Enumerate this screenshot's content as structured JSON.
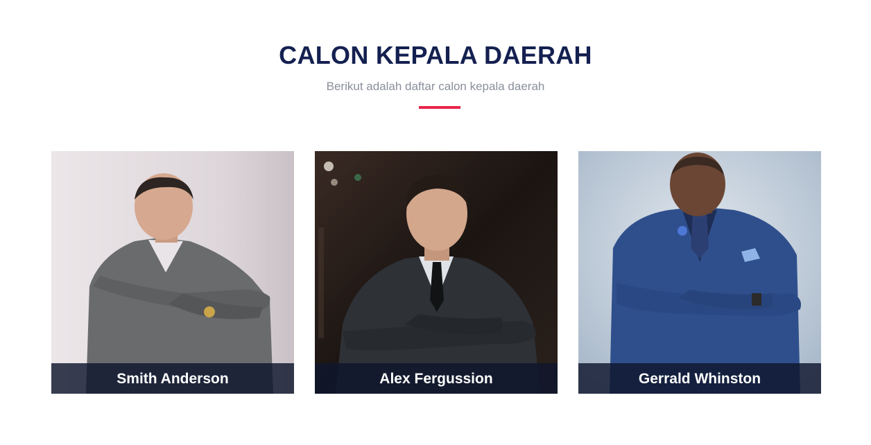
{
  "section": {
    "title": "CALON KEPALA DAERAH",
    "subtitle": "Berikut adalah daftar calon kepala daerah",
    "accent_color": "#e8234a",
    "title_color": "#142050"
  },
  "candidates": [
    {
      "name": "Smith Anderson"
    },
    {
      "name": "Alex Fergussion"
    },
    {
      "name": "Gerrald Whinston"
    }
  ]
}
